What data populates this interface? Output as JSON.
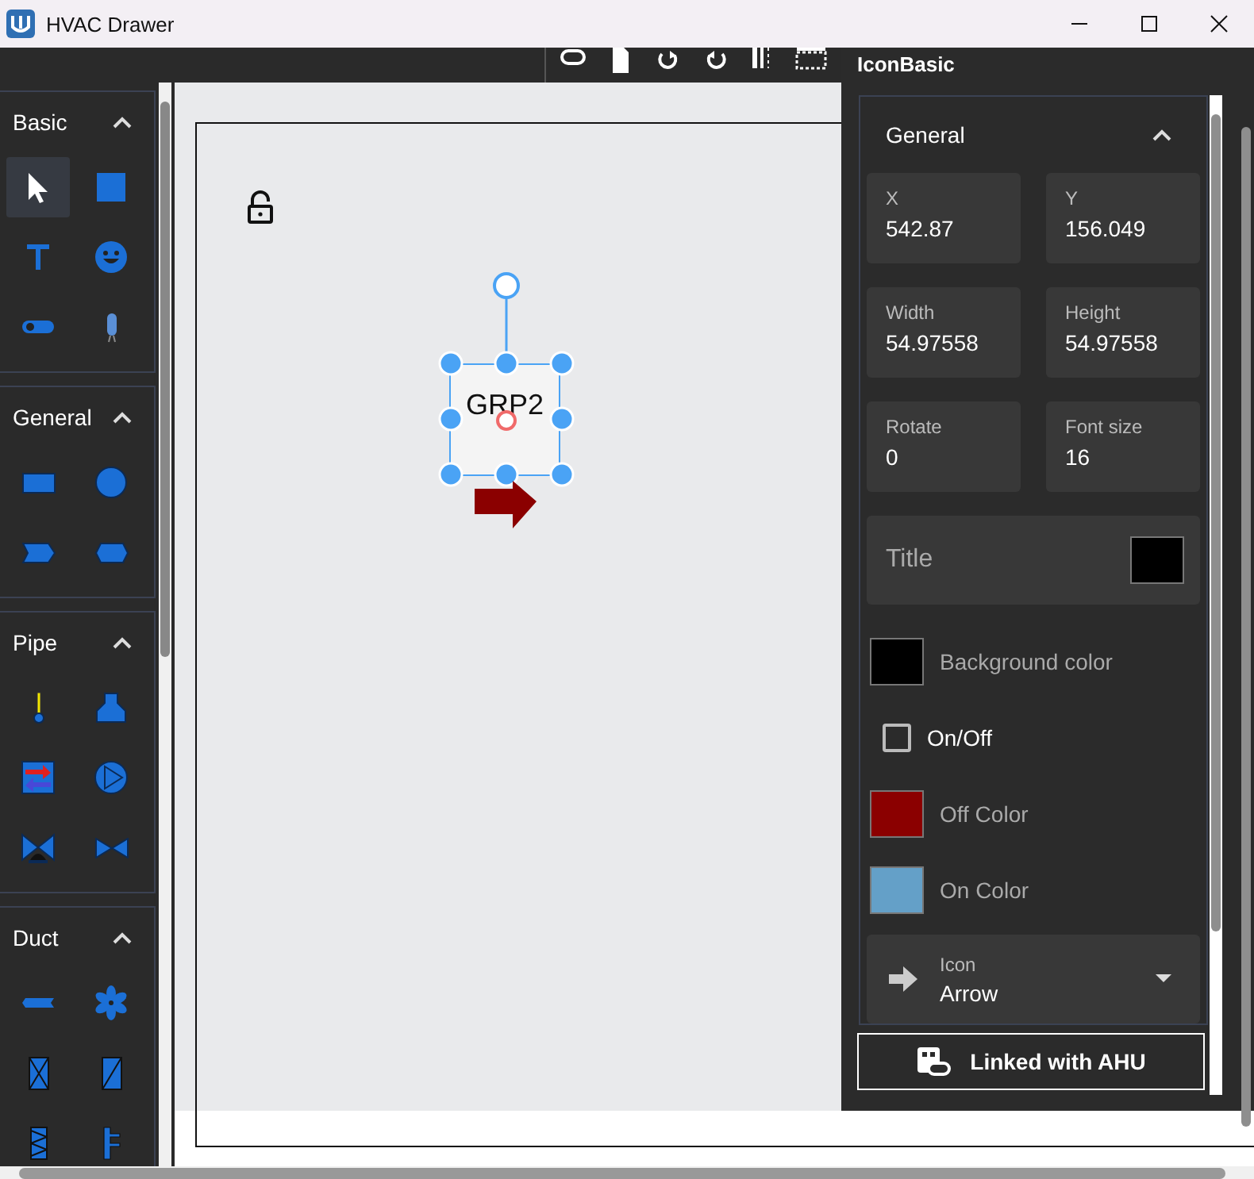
{
  "window": {
    "title": "HVAC Drawer"
  },
  "palette": [
    {
      "title": "Basic",
      "expanded": true,
      "tools": [
        {
          "kind": "pointer",
          "selected": true
        },
        {
          "kind": "square",
          "selected": false
        },
        {
          "kind": "text",
          "selected": false
        },
        {
          "kind": "smiley",
          "selected": false
        },
        {
          "kind": "toggle",
          "selected": false
        },
        {
          "kind": "bulb",
          "selected": false
        }
      ]
    },
    {
      "title": "General",
      "expanded": true,
      "tools": [
        {
          "kind": "rect",
          "selected": false
        },
        {
          "kind": "circle",
          "selected": false
        },
        {
          "kind": "chevron",
          "selected": false
        },
        {
          "kind": "hexagon",
          "selected": false
        }
      ]
    },
    {
      "title": "Pipe",
      "expanded": true,
      "tools": [
        {
          "kind": "thermometer",
          "selected": false
        },
        {
          "kind": "tank",
          "selected": false
        },
        {
          "kind": "exchanger",
          "selected": false
        },
        {
          "kind": "pump",
          "selected": false
        },
        {
          "kind": "actuator-valve",
          "selected": false
        },
        {
          "kind": "valve",
          "selected": false
        }
      ]
    },
    {
      "title": "Duct",
      "expanded": true,
      "tools": [
        {
          "kind": "duct",
          "selected": false
        },
        {
          "kind": "fan",
          "selected": false
        },
        {
          "kind": "filter",
          "selected": false
        },
        {
          "kind": "damper",
          "selected": false
        },
        {
          "kind": "coil",
          "selected": false
        },
        {
          "kind": "manifold",
          "selected": false
        }
      ]
    }
  ],
  "canvas": {
    "locked": false,
    "node": {
      "label": "GRP2",
      "selected": true
    }
  },
  "properties": {
    "title": "IconBasic",
    "section": {
      "title": "General",
      "expanded": true
    },
    "fields": [
      {
        "label": "X",
        "value": "542.87"
      },
      {
        "label": "Y",
        "value": "156.049"
      },
      {
        "label": "Width",
        "value": "54.97558"
      },
      {
        "label": "Height",
        "value": "54.97558"
      },
      {
        "label": "Rotate",
        "value": "0"
      },
      {
        "label": "Font size",
        "value": "16"
      }
    ],
    "rows": [
      {
        "kind": "title",
        "label": "Title",
        "color": "#000000"
      },
      {
        "kind": "color",
        "label": "Background color",
        "color": "#000000"
      },
      {
        "kind": "checkbox",
        "label": "On/Off",
        "checked": false
      },
      {
        "kind": "color",
        "label": "Off Color",
        "color": "#8b0000"
      },
      {
        "kind": "color",
        "label": "On Color",
        "color": "#64a0c8"
      },
      {
        "kind": "select",
        "label": "Icon",
        "value": "Arrow"
      }
    ],
    "button": {
      "label": "Linked with AHU"
    }
  }
}
